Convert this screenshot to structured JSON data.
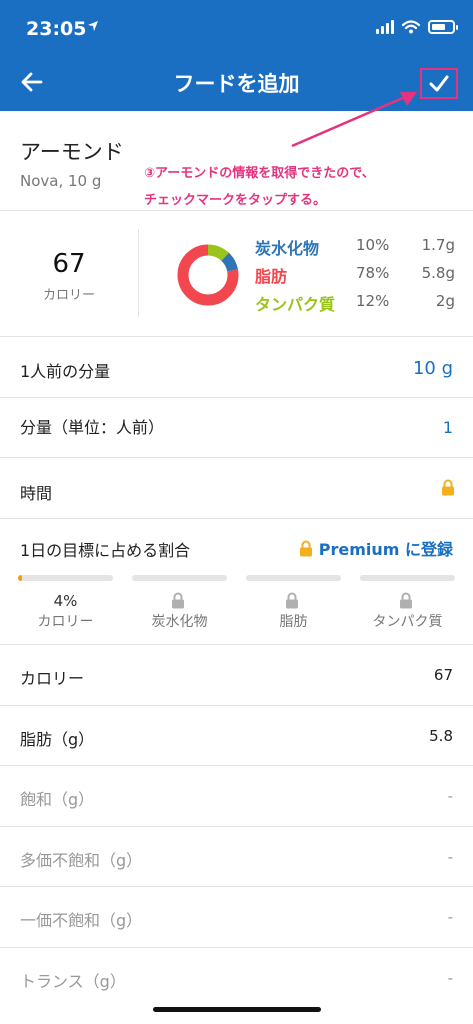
{
  "status": {
    "time": "23:05",
    "location_icon": "location-arrow-icon"
  },
  "nav": {
    "title": "フードを追加",
    "back_icon": "back-arrow-icon",
    "check_icon": "checkmark-icon"
  },
  "food": {
    "name": "アーモンド",
    "detail": "Nova, 10 g"
  },
  "annotation": {
    "line1": "③アーモンドの情報を取得できたので、",
    "line2": "チェックマークをタップする。",
    "color": "#e6337f"
  },
  "summary": {
    "calories": "67",
    "calories_label": "カロリー",
    "macros": [
      {
        "name": "炭水化物",
        "pct": "10%",
        "amount": "1.7g",
        "color": "#2e75b6",
        "share": 0.1
      },
      {
        "name": "脂肪",
        "pct": "78%",
        "amount": "5.8g",
        "color": "#f2474f",
        "share": 0.78
      },
      {
        "name": "タンパク質",
        "pct": "12%",
        "amount": "2g",
        "color": "#9ac31c",
        "share": 0.12
      }
    ]
  },
  "serving": {
    "label": "1人前の分量",
    "value": "10 g"
  },
  "quantity": {
    "label": "分量（単位：人前）",
    "value": "1"
  },
  "time_row": {
    "label": "時間"
  },
  "goals": {
    "title": "1日の目標に占める割合",
    "premium_label": "Premium に登録",
    "items": [
      {
        "label": "カロリー",
        "pct": "4%",
        "fill": 0.04,
        "locked": false
      },
      {
        "label": "炭水化物",
        "locked": true
      },
      {
        "label": "脂肪",
        "locked": true
      },
      {
        "label": "タンパク質",
        "locked": true
      }
    ]
  },
  "nutrients": [
    {
      "label": "カロリー",
      "value": "67",
      "muted": false
    },
    {
      "label": "脂肪（g）",
      "value": "5.8",
      "muted": false
    },
    {
      "label": "飽和（g）",
      "value": "-",
      "muted": true
    },
    {
      "label": "多価不飽和（g）",
      "value": "-",
      "muted": true
    },
    {
      "label": "一価不飽和（g）",
      "value": "-",
      "muted": true
    },
    {
      "label": "トランス（g）",
      "value": "-",
      "muted": true
    }
  ],
  "colors": {
    "primary": "#1b6fc2",
    "lock": "#f2b01e",
    "muted_lock": "#b0b0b0"
  }
}
